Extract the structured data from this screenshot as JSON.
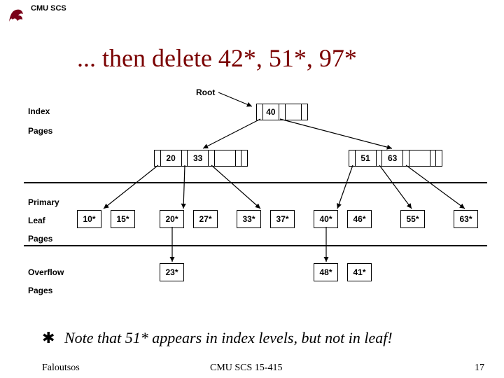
{
  "header": {
    "org": "CMU SCS"
  },
  "title": "... then delete 42*, 51*, 97*",
  "labels": {
    "root": "Root",
    "index": "Index",
    "pages1": "Pages",
    "primary": "Primary",
    "leaf": "Leaf",
    "pages2": "Pages",
    "overflow": "Overflow",
    "pages3": "Pages"
  },
  "nodes": {
    "root": [
      "40"
    ],
    "idx_left": [
      "20",
      "33"
    ],
    "idx_right": [
      "51",
      "63"
    ]
  },
  "leaves": [
    "10*",
    "15*",
    "20*",
    "27*",
    "33*",
    "37*",
    "40*",
    "46*",
    "55*",
    "63*"
  ],
  "overflow": [
    "23*",
    "48*",
    "41*"
  ],
  "note_star": "✱",
  "note": "Note that 51* appears in index levels, but  not in leaf!",
  "footer": {
    "author": "Faloutsos",
    "course": "CMU SCS 15-415",
    "page": "17"
  }
}
